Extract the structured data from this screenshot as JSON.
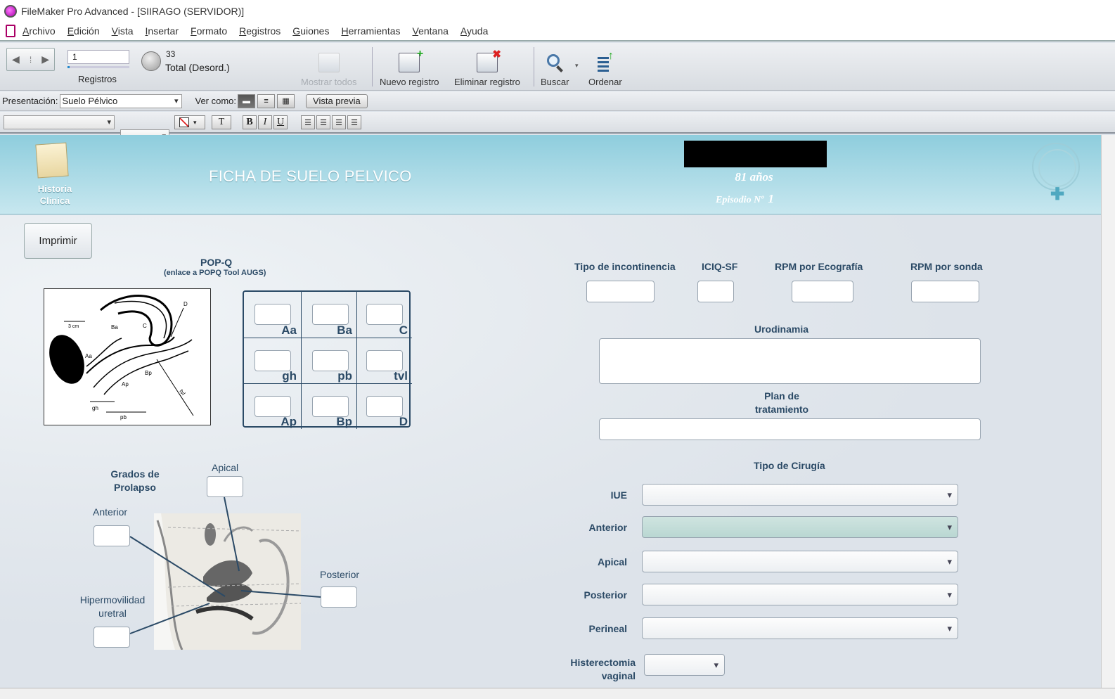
{
  "window": {
    "title": "FileMaker Pro Advanced - [SIIRAGO (SERVIDOR)]"
  },
  "menu": [
    "Archivo",
    "Edición",
    "Vista",
    "Insertar",
    "Formato",
    "Registros",
    "Guiones",
    "Herramientas",
    "Ventana",
    "Ayuda"
  ],
  "toolbar": {
    "record_number": "1",
    "total_count": "33",
    "total_label": "Total (Desord.)",
    "records_label": "Registros",
    "show_all": "Mostrar todos",
    "new_record": "Nuevo registro",
    "delete_record": "Eliminar registro",
    "find": "Buscar",
    "sort": "Ordenar"
  },
  "layoutbar": {
    "layout_label": "Presentación:",
    "layout_value": "Suelo Pélvico",
    "view_as_label": "Ver como:",
    "preview_button": "Vista previa"
  },
  "formatbar": {
    "bold": "B",
    "italic": "I",
    "underline": "U",
    "text": "T"
  },
  "header": {
    "history_label_1": "Historia",
    "history_label_2": "Clínica",
    "title": "FICHA DE SUELO PELVICO",
    "age": "81 años",
    "episode_label": "Episodio Nº",
    "episode_number": "1"
  },
  "form": {
    "print_button": "Imprimir",
    "popq_title": "POP-Q",
    "popq_subtitle": "(enlace a POPQ Tool AUGS)",
    "popq_cells": [
      "Aa",
      "Ba",
      "C",
      "gh",
      "pb",
      "tvl",
      "Ap",
      "Bp",
      "D"
    ],
    "prolapse_title_1": "Grados de",
    "prolapse_title_2": "Prolapso",
    "apical": "Apical",
    "anterior": "Anterior",
    "posterior": "Posterior",
    "hyper_1": "Hipermovilidad",
    "hyper_2": "uretral",
    "incontinence_type": "Tipo de incontinencia",
    "iciq": "ICIQ-SF",
    "rpm_echo": "RPM por Ecografía",
    "rpm_probe": "RPM por sonda",
    "urodynamics": "Urodinamia",
    "plan_1": "Plan de",
    "plan_2": "tratamiento",
    "surgery_type": "Tipo de Cirugía",
    "surgery_rows": [
      "IUE",
      "Anterior",
      "Apical",
      "Posterior",
      "Perineal"
    ],
    "hysterectomy_1": "Histerectomia",
    "hysterectomy_2": "vaginal"
  }
}
